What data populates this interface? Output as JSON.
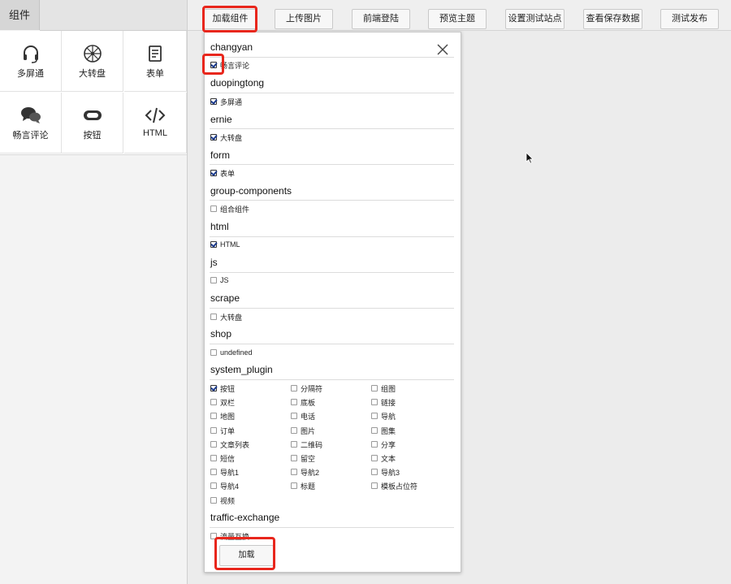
{
  "left_panel": {
    "tab_label": "组件",
    "components": [
      {
        "label": "多屏通",
        "icon": "headset-icon"
      },
      {
        "label": "大转盘",
        "icon": "wheel-icon"
      },
      {
        "label": "表单",
        "icon": "form-icon"
      },
      {
        "label": "畅言评论",
        "icon": "chat-bubbles-icon"
      },
      {
        "label": "按钮",
        "icon": "button-icon"
      },
      {
        "label": "HTML",
        "icon": "code-icon"
      }
    ]
  },
  "toolbar": {
    "buttons": [
      "加载组件",
      "上传图片",
      "前端登陆",
      "预览主题",
      "设置测试站点",
      "查看保存数据",
      "测试发布"
    ]
  },
  "modal": {
    "sections": [
      {
        "title": "changyan",
        "items": [
          {
            "label": "畅言评论",
            "checked": true
          }
        ]
      },
      {
        "title": "duopingtong",
        "items": [
          {
            "label": "多屏通",
            "checked": true
          }
        ]
      },
      {
        "title": "ernie",
        "items": [
          {
            "label": "大转盘",
            "checked": true
          }
        ]
      },
      {
        "title": "form",
        "items": [
          {
            "label": "表单",
            "checked": true
          }
        ]
      },
      {
        "title": "group-components",
        "items": [
          {
            "label": "组合组件",
            "checked": false
          }
        ]
      },
      {
        "title": "html",
        "items": [
          {
            "label": "HTML",
            "checked": true
          }
        ]
      },
      {
        "title": "js",
        "items": [
          {
            "label": "JS",
            "checked": false
          }
        ]
      },
      {
        "title": "scrape",
        "items": [
          {
            "label": "大转盘",
            "checked": false
          }
        ]
      },
      {
        "title": "shop",
        "items": [
          {
            "label": "undefined",
            "checked": false
          }
        ]
      },
      {
        "title": "system_plugin",
        "items": [
          {
            "label": "按钮",
            "checked": true
          },
          {
            "label": "分隔符",
            "checked": false
          },
          {
            "label": "组图",
            "checked": false
          },
          {
            "label": "双栏",
            "checked": false
          },
          {
            "label": "底板",
            "checked": false
          },
          {
            "label": "链接",
            "checked": false
          },
          {
            "label": "地图",
            "checked": false
          },
          {
            "label": "电话",
            "checked": false
          },
          {
            "label": "导航",
            "checked": false
          },
          {
            "label": "订单",
            "checked": false
          },
          {
            "label": "图片",
            "checked": false
          },
          {
            "label": "图集",
            "checked": false
          },
          {
            "label": "文章列表",
            "checked": false
          },
          {
            "label": "二维码",
            "checked": false
          },
          {
            "label": "分享",
            "checked": false
          },
          {
            "label": "短信",
            "checked": false
          },
          {
            "label": "留空",
            "checked": false
          },
          {
            "label": "文本",
            "checked": false
          },
          {
            "label": "导航1",
            "checked": false
          },
          {
            "label": "导航2",
            "checked": false
          },
          {
            "label": "导航3",
            "checked": false
          },
          {
            "label": "导航4",
            "checked": false
          },
          {
            "label": "标题",
            "checked": false
          },
          {
            "label": "模板占位符",
            "checked": false
          },
          {
            "label": "视频",
            "checked": false
          }
        ]
      },
      {
        "title": "traffic-exchange",
        "items": [
          {
            "label": "流量互换",
            "checked": false
          }
        ]
      }
    ],
    "load_button": "加载"
  }
}
